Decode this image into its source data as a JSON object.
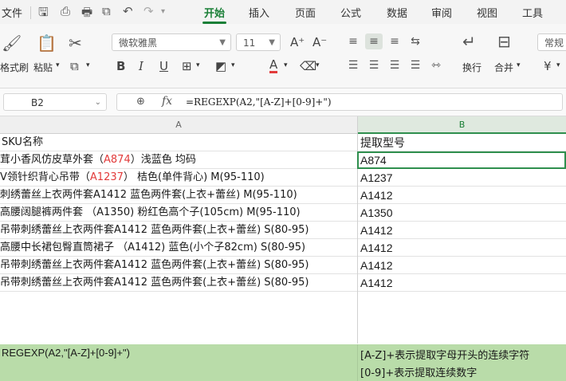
{
  "menu": {
    "file": "文件",
    "tabs": [
      "开始",
      "插入",
      "页面",
      "公式",
      "数据",
      "审阅",
      "视图",
      "工具"
    ],
    "active_tab": "开始"
  },
  "ribbon": {
    "format_painter": "格式刷",
    "paste": "粘贴",
    "font_name": "微软雅黑",
    "font_size": "11",
    "wrap_label": "换行",
    "merge_label": "合并",
    "number_format": "常规",
    "currency": "¥"
  },
  "formula_bar": {
    "cell_ref": "B2",
    "fx": "fx",
    "formula": "=REGEXP(A2,\"[A-Z]+[0-9]+\")"
  },
  "columns": [
    "A",
    "B"
  ],
  "rows": [
    {
      "a_pre": "SKU名称",
      "a_red": "",
      "a_post": "",
      "b": "提取型号"
    },
    {
      "a_pre": "茸小香风仿皮草外套（",
      "a_red": "A874",
      "a_post": "）浅蓝色 均码",
      "b": "A874"
    },
    {
      "a_pre": "V领针织背心吊带（",
      "a_red": "A1237",
      "a_post": "） 桔色(单件背心) M(95-110)",
      "b": "A1237"
    },
    {
      "a_pre": "刺绣蕾丝上衣两件套A1412 蓝色两件套(上衣+蕾丝) M(95-110)",
      "a_red": "",
      "a_post": "",
      "b": "A1412"
    },
    {
      "a_pre": "高腰阔腿裤两件套 （A1350) 粉红色高个子(105cm) M(95-110)",
      "a_red": "",
      "a_post": "",
      "b": "A1350"
    },
    {
      "a_pre": "吊带刺绣蕾丝上衣两件套A1412 蓝色两件套(上衣+蕾丝) S(80-95)",
      "a_red": "",
      "a_post": "",
      "b": "A1412"
    },
    {
      "a_pre": "高腰中长裙包臀直筒裙子 （A1412) 蓝色(小个子82cm) S(80-95)",
      "a_red": "",
      "a_post": "",
      "b": "A1412"
    },
    {
      "a_pre": "吊带刺绣蕾丝上衣两件套A1412 蓝色两件套(上衣+蕾丝) S(80-95)",
      "a_red": "",
      "a_post": "",
      "b": "A1412"
    },
    {
      "a_pre": "吊带刺绣蕾丝上衣两件套A1412 蓝色两件套(上衣+蕾丝) S(80-95)",
      "a_red": "",
      "a_post": "",
      "b": "A1412"
    }
  ],
  "note": {
    "formula": "REGEXP(A2,\"[A-Z]+[0-9]+\")",
    "line1": "[A-Z]+表示提取字母开头的连续字符",
    "line2": "[0-9]+表示提取连续数字"
  },
  "colors": {
    "accent": "#1a7f37",
    "highlight_red": "#e23b3b",
    "note_bg": "#b9dca9"
  }
}
